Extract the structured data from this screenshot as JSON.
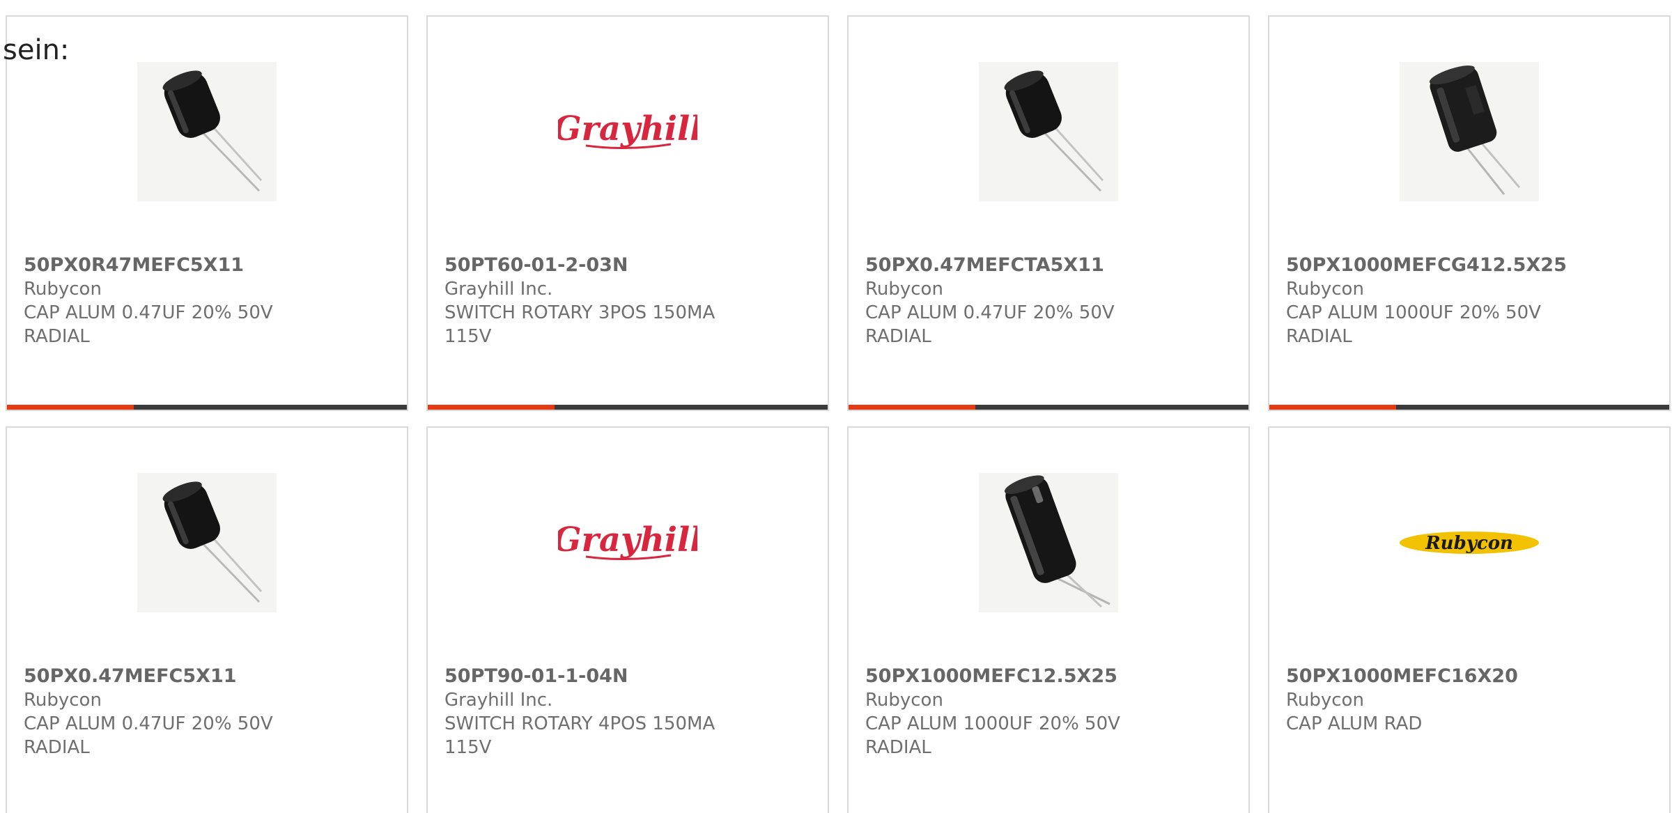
{
  "header_fragment": "sein:",
  "colors": {
    "accent": "#e53a14",
    "bar_dark": "#3a3a3a",
    "text": "#6f6f6f",
    "grayhill_red": "#d7263d",
    "rubycon_yellow": "#f2c200"
  },
  "products": [
    {
      "part_number": "50PX0R47MEFC5X11",
      "manufacturer": "Rubycon",
      "description": "CAP ALUM 0.47UF 20% 50V RADIAL",
      "image": "capacitor-small-icon"
    },
    {
      "part_number": "50PT60-01-2-03N",
      "manufacturer": "Grayhill Inc.",
      "description": "SWITCH ROTARY 3POS 150MA 115V",
      "image": "grayhill-logo",
      "logo_text": "Grayhill"
    },
    {
      "part_number": "50PX0.47MEFCTA5X11",
      "manufacturer": "Rubycon",
      "description": "CAP ALUM 0.47UF 20% 50V RADIAL",
      "image": "capacitor-small-icon"
    },
    {
      "part_number": "50PX1000MEFCG412.5X25",
      "manufacturer": "Rubycon",
      "description": "CAP ALUM 1000UF 20% 50V RADIAL",
      "image": "capacitor-large-icon"
    },
    {
      "part_number": "50PX0.47MEFC5X11",
      "manufacturer": "Rubycon",
      "description": "CAP ALUM 0.47UF 20% 50V RADIAL",
      "image": "capacitor-small-icon"
    },
    {
      "part_number": "50PT90-01-1-04N",
      "manufacturer": "Grayhill Inc.",
      "description": "SWITCH ROTARY 4POS 150MA 115V",
      "image": "grayhill-logo",
      "logo_text": "Grayhill"
    },
    {
      "part_number": "50PX1000MEFC12.5X25",
      "manufacturer": "Rubycon",
      "description": "CAP ALUM 1000UF 20% 50V RADIAL",
      "image": "capacitor-tall-icon"
    },
    {
      "part_number": "50PX1000MEFC16X20",
      "manufacturer": "Rubycon",
      "description": "CAP ALUM RAD",
      "image": "rubycon-logo",
      "logo_text": "Rubycon"
    }
  ]
}
